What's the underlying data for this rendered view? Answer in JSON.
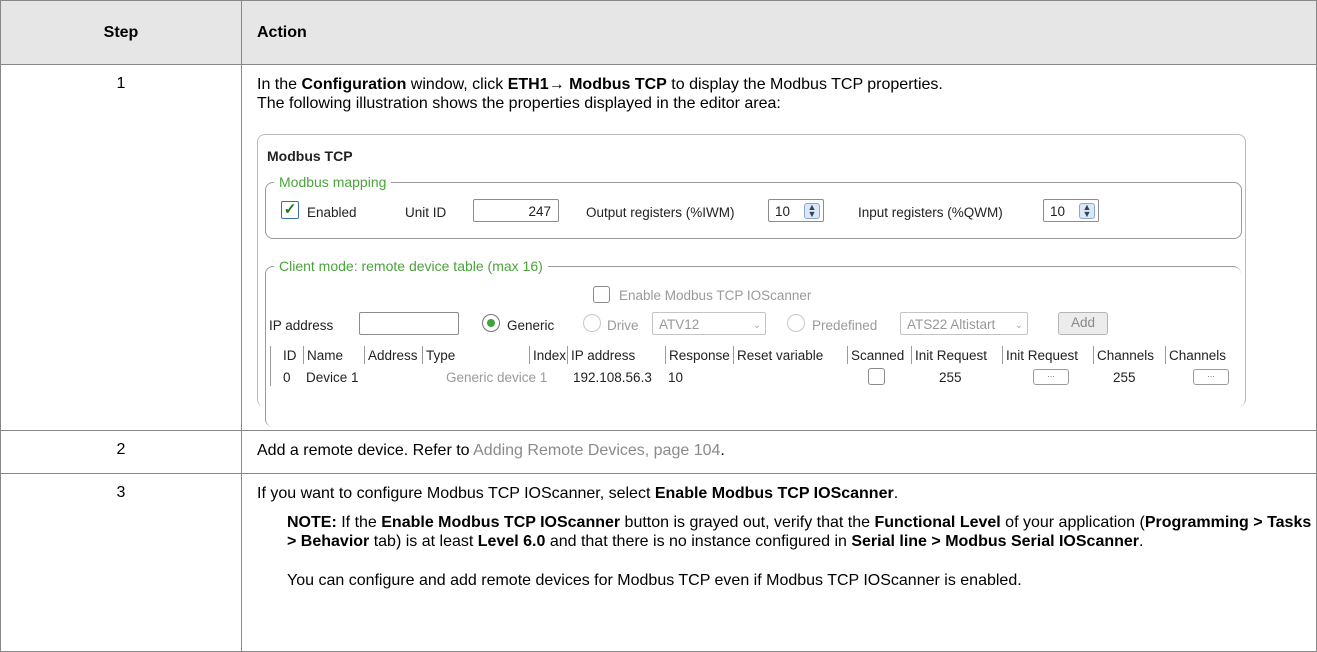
{
  "header": {
    "step": "Step",
    "action": "Action"
  },
  "rows": [
    {
      "step": "1",
      "line1": {
        "t1": "In the ",
        "b1": "Configuration",
        "t2": " window, click ",
        "b2": "ETH1",
        "arrow": "→",
        "b3": " Modbus TCP",
        "t3": " to display the Modbus TCP properties."
      },
      "line2": "The following illustration shows the properties displayed in the editor area:"
    },
    {
      "step": "2",
      "text": "Add a remote device. Refer to ",
      "link": "Adding Remote Devices, page 104",
      "after": "."
    },
    {
      "step": "3",
      "intro": {
        "t1": "If you want to configure Modbus TCP IOScanner, select ",
        "b1": "Enable Modbus TCP IOScanner",
        "t2": "."
      },
      "note": {
        "label": "NOTE:",
        "t1": " If the ",
        "b1": "Enable Modbus TCP IOScanner",
        "t2": " button is grayed out, verify that the ",
        "b2": "Functional Level",
        "t3": " of your application (",
        "b3": "Programming",
        "gt1": " > ",
        "b4": "Tasks",
        "gt2": " > ",
        "b5": "Behavior",
        "t4": " tab) is at least ",
        "b6": "Level 6.0",
        "t5": " and that there is no instance configured in ",
        "b7": "Serial line",
        "gt3": " > ",
        "b8": "Modbus Serial IOScanner",
        "t6": "."
      },
      "closing": "You can configure and add remote devices for Modbus TCP even if Modbus TCP IOScanner is enabled."
    }
  ],
  "panel": {
    "title": "Modbus TCP",
    "mapping": {
      "legend": "Modbus mapping",
      "enabled_label": "Enabled",
      "unit_id_label": "Unit ID",
      "unit_id_value": "247",
      "output_label": "Output registers (%IWM)",
      "output_value": "10",
      "input_label": "Input registers (%QWM)",
      "input_value": "10"
    },
    "client": {
      "legend": "Client mode: remote device table (max 16)",
      "enable_scanner_label": "Enable Modbus TCP IOScanner",
      "ip_label": "IP address",
      "radio_generic": "Generic",
      "radio_drive": "Drive",
      "drive_select": "ATV12",
      "radio_predefined": "Predefined",
      "predefined_select": "ATS22 Altistart",
      "add_button": "Add",
      "columns": [
        "ID",
        "Name",
        "Address",
        "Type",
        "Index",
        "IP address",
        "Response",
        "Reset variable",
        "Scanned",
        "Init Request",
        "Init Request",
        "Channels",
        "Channels"
      ],
      "row": {
        "id": "0",
        "name": "Device 1",
        "type": "Generic device 1",
        "ip": "192.108.56.3",
        "response": "10",
        "init_request": "255",
        "init_dots": "...",
        "channels": "255",
        "channels_dots": "..."
      }
    }
  }
}
